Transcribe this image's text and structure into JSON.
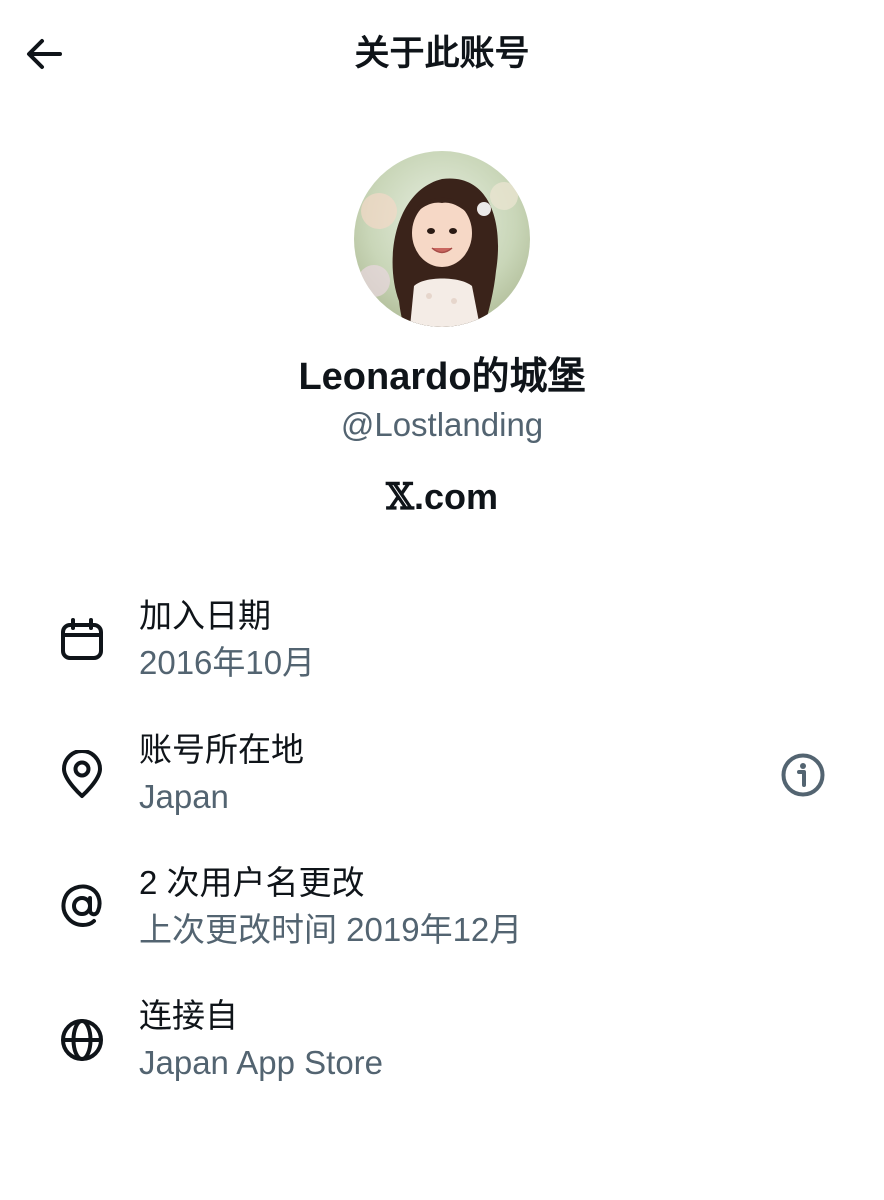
{
  "header": {
    "title": "关于此账号",
    "back_icon": "arrow-left-icon"
  },
  "profile": {
    "avatar": "profile-avatar",
    "display_name": "Leonardo的城堡",
    "handle": "@Lostlanding",
    "site_x": "𝕏",
    "site_rest": ".com"
  },
  "info_rows": [
    {
      "icon": "calendar-icon",
      "label": "加入日期",
      "value": "2016年10月"
    },
    {
      "icon": "location-pin-icon",
      "label": "账号所在地",
      "value": "Japan",
      "action_icon": "info-icon"
    },
    {
      "icon": "at-sign-icon",
      "label": "2 次用户名更改",
      "value": "上次更改时间 2019年12月"
    },
    {
      "icon": "globe-icon",
      "label": "连接自",
      "value": "Japan App Store"
    }
  ],
  "colors": {
    "text_primary": "#0f1419",
    "text_secondary": "#536471",
    "background": "#ffffff"
  }
}
